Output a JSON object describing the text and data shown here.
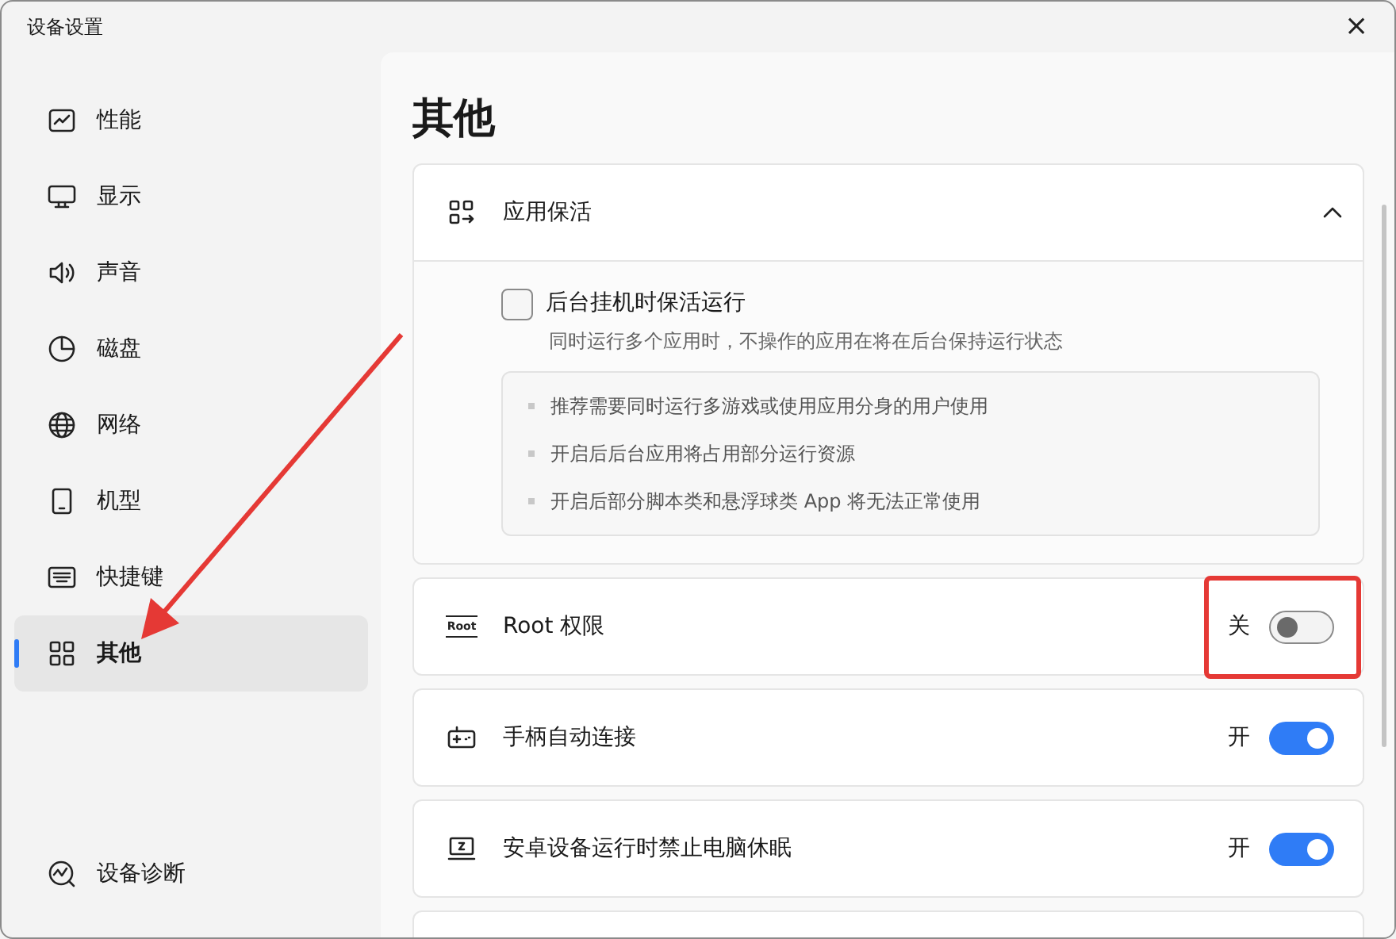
{
  "window": {
    "title": "设备设置",
    "close": "×"
  },
  "sidebar": {
    "items": [
      {
        "label": "性能",
        "selected": false
      },
      {
        "label": "显示",
        "selected": false
      },
      {
        "label": "声音",
        "selected": false
      },
      {
        "label": "磁盘",
        "selected": false
      },
      {
        "label": "网络",
        "selected": false
      },
      {
        "label": "机型",
        "selected": false
      },
      {
        "label": "快捷键",
        "selected": false
      },
      {
        "label": "其他",
        "selected": true
      }
    ],
    "footer": {
      "label": "设备诊断"
    }
  },
  "page": {
    "title": "其他",
    "expander": {
      "title": "应用保活",
      "expanded": true,
      "option": {
        "label": "后台挂机时保活运行",
        "checked": false,
        "description": "同时运行多个应用时，不操作的应用在将在后台保持运行状态"
      },
      "notes": [
        "推荐需要同时运行多游戏或使用应用分身的用户使用",
        "开启后后台应用将占用部分运行资源",
        "开启后部分脚本类和悬浮球类 App 将无法正常使用"
      ]
    },
    "settings": [
      {
        "label": "Root 权限",
        "icon_text": "Root",
        "state_text": "关",
        "on": false,
        "highlighted": true
      },
      {
        "label": "手柄自动连接",
        "state_text": "开",
        "on": true,
        "highlighted": false
      },
      {
        "label": "安卓设备运行时禁止电脑休眠",
        "state_text": "开",
        "on": true,
        "highlighted": false
      }
    ]
  },
  "annotations": [
    {
      "kind": "arrow"
    }
  ]
}
